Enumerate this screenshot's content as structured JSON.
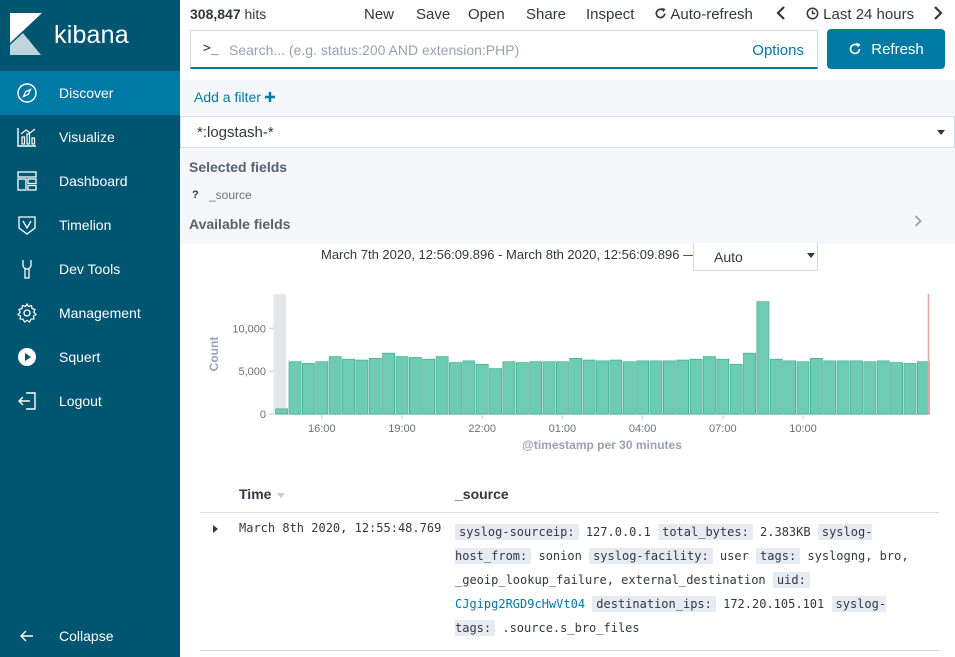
{
  "brand": {
    "name": "kibana"
  },
  "sidebar": {
    "items": [
      {
        "label": "Discover",
        "icon": "compass-icon"
      },
      {
        "label": "Visualize",
        "icon": "visualize-icon"
      },
      {
        "label": "Dashboard",
        "icon": "dashboard-icon"
      },
      {
        "label": "Timelion",
        "icon": "timelion-icon"
      },
      {
        "label": "Dev Tools",
        "icon": "wrench-icon"
      },
      {
        "label": "Management",
        "icon": "gear-icon"
      },
      {
        "label": "Squert",
        "icon": "play-icon"
      },
      {
        "label": "Logout",
        "icon": "logout-icon"
      }
    ],
    "collapse_label": "Collapse"
  },
  "topbar": {
    "hits_count": "308,847",
    "hits_label": "hits",
    "new_label": "New",
    "save_label": "Save",
    "open_label": "Open",
    "share_label": "Share",
    "inspect_label": "Inspect",
    "autorefresh_label": "Auto-refresh",
    "timepicker_label": "Last 24 hours"
  },
  "search": {
    "prompt": ">_",
    "placeholder": "Search... (e.g. status:200 AND extension:PHP)",
    "value": "",
    "options_label": "Options",
    "refresh_label": "Refresh"
  },
  "filterbar": {
    "add_filter_label": "Add a filter"
  },
  "fields": {
    "index_pattern": "*:logstash-*",
    "selected_title": "Selected fields",
    "source_type": "?",
    "source_field": "_source",
    "available_title": "Available fields"
  },
  "timerange": {
    "label": "March 7th 2020, 12:56:09.896 - March 8th 2020, 12:56:09.896 —",
    "interval": "Auto"
  },
  "chart_data": {
    "type": "bar",
    "ylabel": "Count",
    "xlabel": "@timestamp per 30 minutes",
    "ylim": [
      0,
      14000
    ],
    "yticks": [
      0,
      5000,
      10000
    ],
    "ytick_labels": [
      "0",
      "5,000",
      "10,000"
    ],
    "xtick_labels": [
      "16:00",
      "19:00",
      "22:00",
      "01:00",
      "04:00",
      "07:00",
      "10:00"
    ],
    "xtick_positions": [
      3.5,
      9.5,
      15.5,
      21.5,
      27.5,
      33.5,
      39.5
    ],
    "values": [
      600,
      6100,
      5900,
      6100,
      6700,
      6400,
      6300,
      6500,
      7100,
      6700,
      6600,
      6400,
      6700,
      6000,
      6200,
      5800,
      5300,
      6100,
      6000,
      6100,
      6100,
      6100,
      6500,
      6300,
      6200,
      6300,
      6100,
      6200,
      6200,
      6200,
      6300,
      6400,
      6700,
      6400,
      5800,
      7100,
      13100,
      6400,
      6200,
      6100,
      6500,
      6200,
      6200,
      6200,
      6100,
      6200,
      6000,
      5900,
      6100
    ],
    "bar_color": "#6dccb1",
    "bar_edge": "#3aa58a",
    "grid": false,
    "legend": "none"
  },
  "table": {
    "time_header": "Time",
    "source_header": "_source",
    "rows": [
      {
        "time": "March 8th 2020, 12:55:48.769",
        "source": [
          {
            "k": "syslog-sourceip:",
            "v": "127.0.0.1"
          },
          {
            "k": "total_bytes:",
            "v": "2.383KB"
          },
          {
            "k": "syslog-host_from:",
            "v": "sonion"
          },
          {
            "k": "syslog-facility:",
            "v": "user"
          },
          {
            "k": "tags:",
            "v": "syslogng, bro, _geoip_lookup_failure, external_destination"
          },
          {
            "k": "uid:",
            "v": "CJgipg2RGD9cHwVt04",
            "link": true
          },
          {
            "k": "destination_ips:",
            "v": "172.20.105.101"
          },
          {
            "k": "syslog-tags:",
            "v": ".source.s_bro_files"
          }
        ]
      }
    ]
  }
}
